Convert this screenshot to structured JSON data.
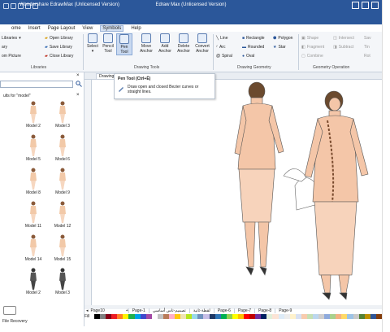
{
  "title": "Wondershare EdrawMax (Unlicensed Version)",
  "center_title": "Edraw Max (Unlicensed Version)",
  "menu": [
    "ome",
    "Insert",
    "Page Layout",
    "View",
    "Symbols",
    "Help"
  ],
  "library_items": [
    "Libraries",
    "ary",
    "om Picture",
    "Open Library",
    "Save Library",
    "Close Library"
  ],
  "tools": [
    {
      "label": "Select",
      "sub": "▾"
    },
    {
      "label": "Pencil",
      "sub": "Tool"
    },
    {
      "label": "Pen",
      "sub": "Tool"
    },
    {
      "label": "Move",
      "sub": "Anchor"
    },
    {
      "label": "Add",
      "sub": "Anchor"
    },
    {
      "label": "Delete",
      "sub": "Anchor"
    },
    {
      "label": "Convert",
      "sub": "Anchor"
    }
  ],
  "geometry_items": [
    "Line",
    "Rectangle",
    "Polygon",
    "Arc",
    "Rounded",
    "Star",
    "Spiral",
    "Oval"
  ],
  "geo_op_items": [
    "Shape",
    "Intersect",
    "Fragment",
    "Subtract",
    "Combine"
  ],
  "geo_op_items2": [
    "Sav",
    "Tin",
    "Rot"
  ],
  "group_labels": [
    "Libraries",
    "Drawing Tools",
    "Drawing Geometry",
    "Geometry Operation"
  ],
  "doc_tab": "Drawing1",
  "tooltip": {
    "title": "Pen Tool (Ctrl+Ë)",
    "desc": "Draw open and closed Bezier curves or straight lines."
  },
  "results_label": "ults for \"model\"",
  "shapes": [
    "Model 2",
    "Model 3",
    "Model 5",
    "Model 6",
    "Model 8",
    "Model 9",
    "Model 11",
    "Model 12",
    "Model 14",
    "Model 15",
    "Model 2",
    "Model 3"
  ],
  "left_bottom": "File Recovery",
  "lp_bottom_label": "pe",
  "page_current": "Page10",
  "pages": [
    "Page-1",
    "تصميم-تاس أساسي",
    "لقطة-ثانية",
    "Page-6",
    "Page-7",
    "Page-8",
    "Page-9"
  ],
  "fill_label": "Fill",
  "palette": [
    "#000000",
    "#7f7f7f",
    "#880015",
    "#ed1c24",
    "#ff7f27",
    "#fff200",
    "#22b14c",
    "#00a2e8",
    "#3f48cc",
    "#a349a4",
    "#ffffff",
    "#c3c3c3",
    "#b97a57",
    "#ffaec9",
    "#ffc90e",
    "#efe4b0",
    "#b5e61d",
    "#99d9ea",
    "#7092be",
    "#c8bfe7",
    "#1f3864",
    "#2e75b6",
    "#00b050",
    "#92d050",
    "#ffff00",
    "#ffc000",
    "#ff0000",
    "#c00000",
    "#7030a0",
    "#002060",
    "#e2efda",
    "#fce4d6",
    "#ddebf7",
    "#ededed",
    "#fff2cc",
    "#d9e1f2",
    "#f8cbad",
    "#c6e0b4",
    "#bdd7ee",
    "#d0cece",
    "#8faadc",
    "#a9d18e",
    "#f4b183",
    "#ffd966",
    "#9dc3e6",
    "#c9c9c9",
    "#548235",
    "#bf9000",
    "#2f5597",
    "#833c0b"
  ]
}
